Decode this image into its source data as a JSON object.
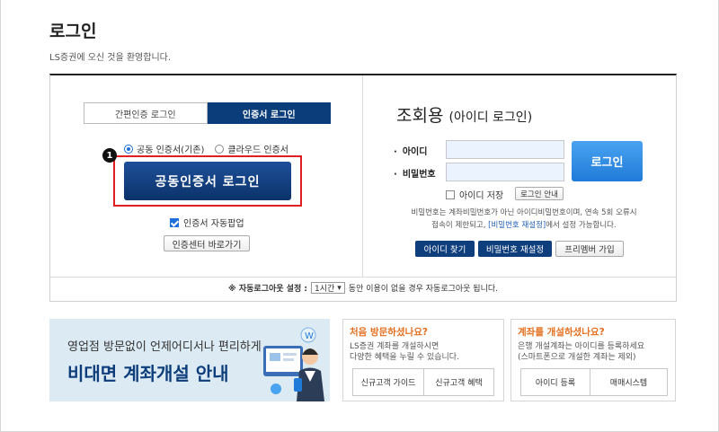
{
  "header": {
    "title": "로그인",
    "welcome": "LS증권에 오신 것을 환영합니다."
  },
  "cert_panel": {
    "tabs": [
      {
        "label": "간편인증 로그인",
        "active": false
      },
      {
        "label": "인증서 로그인",
        "active": true
      }
    ],
    "radio_options": [
      {
        "label": "공동 인증서(기존)",
        "selected": true
      },
      {
        "label": "클라우드 인증서",
        "selected": false
      }
    ],
    "marker": "1",
    "login_button": "공동인증서 로그인",
    "auto_popup_label": "인증서 자동팝업",
    "auto_popup_checked": true,
    "cert_center_button": "인증센터 바로가기"
  },
  "id_panel": {
    "title": "조회용",
    "title_sub": "(아이디 로그인)",
    "id_label": "아이디",
    "id_value": "",
    "pw_label": "비밀번호",
    "pw_value": "",
    "login_button": "로그인",
    "save_id_label": "아이디 저장",
    "save_id_checked": false,
    "login_info_button": "로그인 안내",
    "notice_line1": "비밀번호는 계좌비밀번호가 아닌 아이디비밀번호이며, 연속 5회 오류시",
    "notice_line2_pre": "접속이 제한되고, ",
    "notice_link": "[비밀번호 재설정]",
    "notice_line2_post": "에서 설정 가능합니다.",
    "find_id_button": "아이디 찾기",
    "reset_pw_button": "비밀번호 재설정",
    "free_member_button": "프리멤버 가입"
  },
  "auto_logout": {
    "label": "※ 자동로그아웃 설정 :",
    "selected": "1시간",
    "suffix": "동안 이용이 없을 경우 자동로그아웃 됩니다."
  },
  "banner": {
    "line1": "영업점 방문없이 언제어디서나 편리하게",
    "line2": "비대면 계좌개설 안내"
  },
  "first_visit": {
    "heading": "처음 방문하셨나요?",
    "desc1": "LS증권 계좌를 개설하시면",
    "desc2": "다양한 혜택을 누릴 수 있습니다.",
    "buttons": [
      "신규고객 가이드",
      "신규고객 혜택"
    ]
  },
  "have_account": {
    "heading": "계좌를 개설하셨나요?",
    "desc1": "은행 개설계좌는 아이디를 등록하세요",
    "desc2": "(스마트폰으로 개설한 계좌는 제외)",
    "buttons": [
      "아이디 등록",
      "매매시스템"
    ]
  },
  "colors": {
    "navy": "#0b3d7a",
    "blue": "#1f7bd8",
    "orange": "#e36f1e",
    "red_highlight": "#e02020"
  }
}
